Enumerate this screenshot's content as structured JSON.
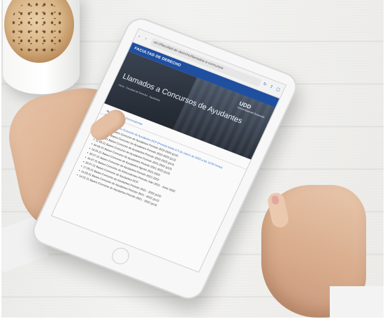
{
  "browser": {
    "url_text": "ud.cl/facultad-de-derecho/llamados-a-concursos"
  },
  "site": {
    "section_title": "FACULTAD DE DERECHO",
    "logo_text": "UDD",
    "logo_caption": "Universidad del Desarrollo",
    "hero_title": "Llamados a Concursos de Ayudantes",
    "breadcrumb": "Inicio · Facultad de Derecho · Ayudantes"
  },
  "tabs": [
    "Ayudantes",
    "Convocatorias"
  ],
  "list_items": [
    {
      "date": "03.03.23",
      "text": "Bases Concurso de Ayudantes DCP (Postula hasta el 3 de marzo de 2023 a las 12:00 horas)",
      "style": "link"
    },
    {
      "date": "05.11.21",
      "text": "Bases Concurso de Ayudantes Periodo 2022-2023 (p12)",
      "style": "plain"
    },
    {
      "date": "05.11.21",
      "text": "Bases Concurso de Ayudantes Periodo 2022-2023 (p12)",
      "style": "plain"
    },
    {
      "date": "24.09.21",
      "text": "Bases Concurso de Ayudantes Periodo 2022-2023 (p14)",
      "style": "plain"
    },
    {
      "date": "11.06.21",
      "text": "Bases Concurso de Ayudantes Periodo 2021-2022 (p12)",
      "style": "plain"
    },
    {
      "date": "04.06.21",
      "text": "Bases Concurso de Ayudantes Periodo 2021-2022 (p12)",
      "style": "plain"
    },
    {
      "date": "16.04.21",
      "text": "Bases Concurso de Ayudantes Agosto 2021-2022",
      "style": "plain"
    },
    {
      "date": "30.07.21",
      "text": "Bases Concurso de Ayudantes Periodo 2021-2022",
      "style": "plain"
    },
    {
      "date": "16.07.21",
      "text": "Bases Concurso de Antecedentes Periodo Julio 2021 - Junio 2022",
      "style": "plain"
    },
    {
      "date": "20.07.21",
      "text": "Bases Concurso de Ayudantes DCP",
      "style": "plain"
    },
    {
      "date": "17.05.21",
      "text": "Bases Concurso de Ayudantes Periodo 2021 - 2022 (p10)",
      "style": "plain"
    },
    {
      "date": "14.05.21",
      "text": "Bases Concurso de Ayudantes Periodo 2021 - 2022 (p12)",
      "style": "plain"
    },
    {
      "date": "14.01.21",
      "text": "Bases Concurso de Ayudantes Periodo 2021 - 2022 (p13)",
      "style": "plain"
    }
  ],
  "colors": {
    "header_blue": "#1f4fa0",
    "link_blue": "#2f6fd0"
  },
  "icons": [
    "back-icon",
    "forward-icon",
    "reload-icon",
    "share-icon",
    "bookmark-icon",
    "tabs-icon",
    "search-icon"
  ]
}
